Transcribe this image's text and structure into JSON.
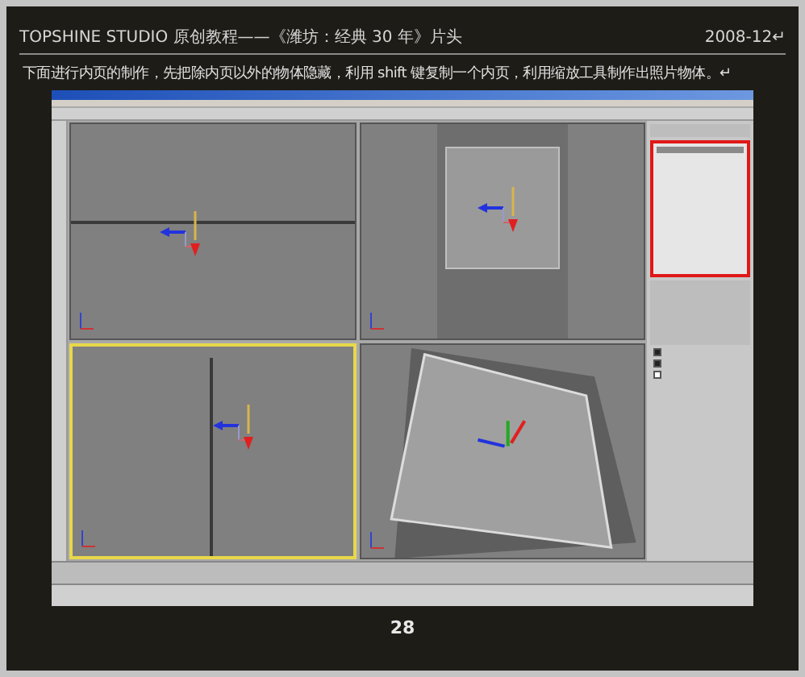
{
  "header": {
    "title": "TOPSHINE STUDIO 原创教程——《潍坊：经典 30 年》片头",
    "date": "2008-12↵"
  },
  "instruction": "下面进行内页的制作，先把除内页以外的物体隐藏，利用 shift 键复制一个内页，利用缩放工具制作出照片物体。↵",
  "app": {
    "viewports": [
      {
        "kind": "front",
        "selected": false
      },
      {
        "kind": "top",
        "selected": false
      },
      {
        "kind": "left",
        "selected": true
      },
      {
        "kind": "perspective",
        "selected": false
      }
    ],
    "panel_checkboxes": [
      {
        "checked": true
      },
      {
        "checked": true
      },
      {
        "checked": false
      }
    ]
  },
  "page_number": "28"
}
